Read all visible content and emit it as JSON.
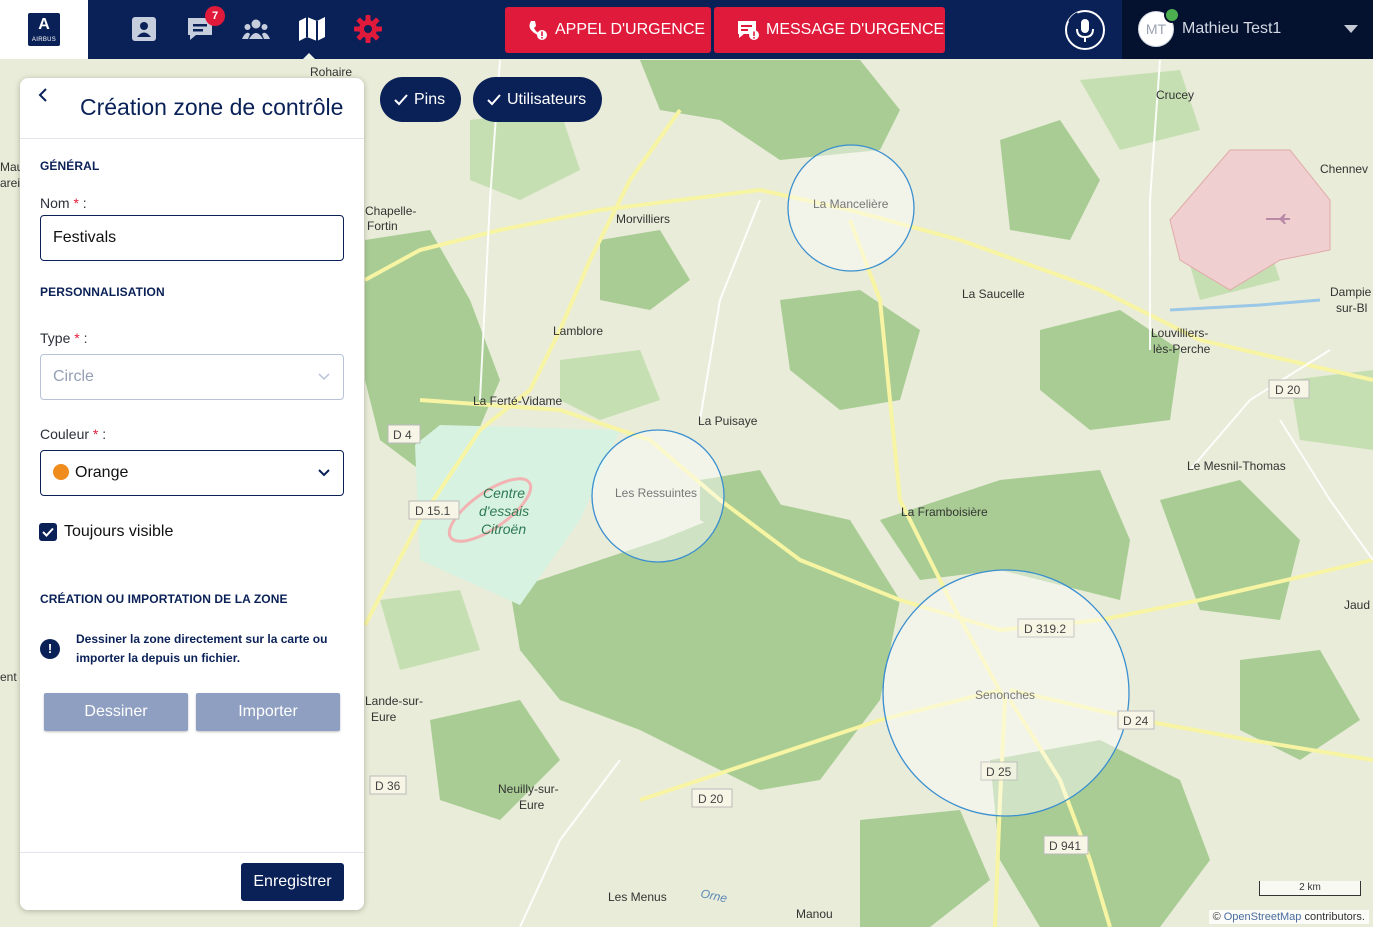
{
  "header": {
    "logo_text": "AIRBUS",
    "nav": [
      {
        "name": "contacts",
        "icon": "contact-card-icon"
      },
      {
        "name": "messages",
        "icon": "message-icon",
        "badge": "7"
      },
      {
        "name": "groups",
        "icon": "group-icon"
      },
      {
        "name": "map",
        "icon": "map-icon",
        "active": true
      },
      {
        "name": "settings",
        "icon": "gear-icon"
      }
    ],
    "emergency_call_label": "APPEL D'URGENCE",
    "emergency_message_label": "MESSAGE D'URGENCE",
    "user": {
      "initials": "MT",
      "name": "Mathieu Test1",
      "status": "online"
    }
  },
  "map": {
    "chips": [
      {
        "label": "Pins",
        "checked": true
      },
      {
        "label": "Utilisateurs",
        "checked": true
      }
    ],
    "places": [
      "Rohaire",
      "Crucey",
      "Chennev",
      "Chapelle-",
      "Fortin",
      "Morvilliers",
      "La Mancelière",
      "La Saucelle",
      "Dampie",
      "sur-Bl",
      "Lamblore",
      "Louvilliers-",
      "lès-Perche",
      "La Ferté-Vidame",
      "La Puisaye",
      "Les Ressuintes",
      "Le Mesnil-Thomas",
      "La Framboisière",
      "Centre",
      "d'essais",
      "Citroën",
      "Senonches",
      "Jaud",
      "Lande-sur-",
      "Eure",
      "Neuilly-sur-",
      "Eure",
      "Les Menus",
      "Manou",
      "Orne",
      "Mau",
      "arei",
      "ent"
    ],
    "roads": [
      "D 4",
      "D 15.1",
      "D 20",
      "D 20",
      "D 319.2",
      "D 24",
      "D 25",
      "D 36",
      "D 941"
    ],
    "scale_label": "2 km",
    "attribution_prefix": "© ",
    "attribution_link": "OpenStreetMap",
    "attribution_suffix": " contributors."
  },
  "panel": {
    "title": "Création zone de contrôle",
    "section_general": "GÉNÉRAL",
    "name_label": "Nom",
    "name_required": "*",
    "name_sep": " :",
    "name_value": "Festivals",
    "section_custom": "PERSONNALISATION",
    "type_label": "Type",
    "type_required": "*",
    "type_sep": " :",
    "type_value": "Circle",
    "color_label": "Couleur",
    "color_required": "*",
    "color_sep": " :",
    "color_value": "Orange",
    "color_hex": "#f08b1d",
    "always_visible_label": "Toujours visible",
    "always_visible_checked": true,
    "section_zone": "CRÉATION OU IMPORTATION DE LA ZONE",
    "info_icon": "!",
    "info_text": "Dessiner la zone directement sur la carte ou importer la depuis un fichier.",
    "draw_button": "Dessiner",
    "import_button": "Importer",
    "save_button": "Enregistrer"
  },
  "colors": {
    "navy": "#0a2157",
    "emergency_red": "#e01a3b",
    "zone_circle": "#3a8fd0"
  }
}
